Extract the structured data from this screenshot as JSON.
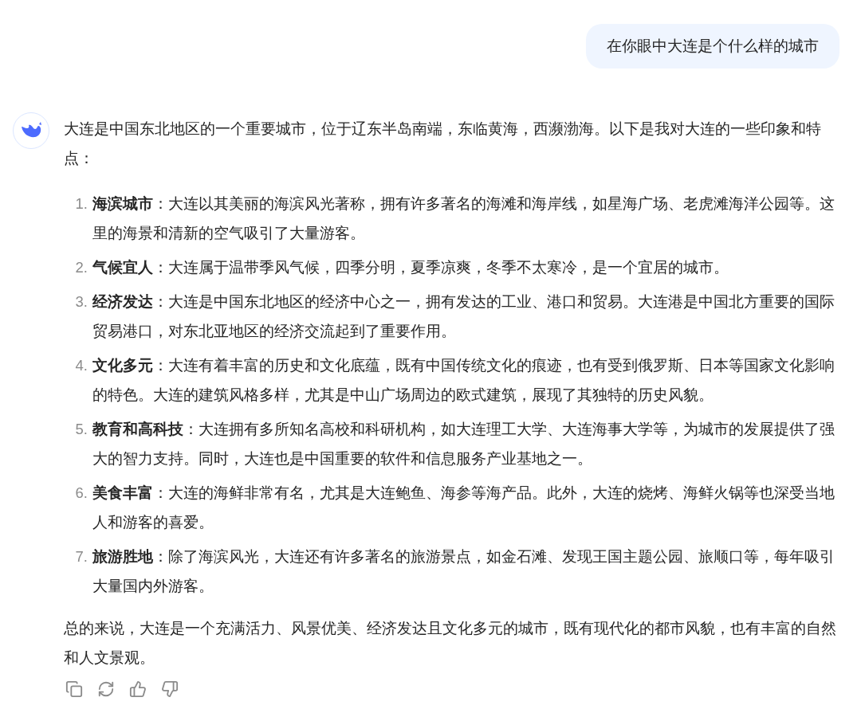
{
  "user_message": "在你眼中大连是个什么样的城市",
  "reply": {
    "intro": "大连是中国东北地区的一个重要城市，位于辽东半岛南端，东临黄海，西濒渤海。以下是我对大连的一些印象和特点：",
    "items": [
      {
        "number": "1.",
        "text": "**海滨城市**：大连以其美丽的海滨风光著称，拥有许多著名的海滩和海岸线，如星海广场、老虎滩海洋公园等。这里的海景和清新的空气吸引了大量游客。"
      },
      {
        "number": "2.",
        "text": "**气候宜人**：大连属于温带季风气候，四季分明，夏季凉爽，冬季不太寒冷，是一个宜居的城市。"
      },
      {
        "number": "3.",
        "text": "**经济发达**：大连是中国东北地区的经济中心之一，拥有发达的工业、港口和贸易。大连港是中国北方重要的国际贸易港口，对东北亚地区的经济交流起到了重要作用。"
      },
      {
        "number": "4.",
        "text": "**文化多元**：大连有着丰富的历史和文化底蕴，既有中国传统文化的痕迹，也有受到俄罗斯、日本等国家文化影响的特色。大连的建筑风格多样，尤其是中山广场周边的欧式建筑，展现了其独特的历史风貌。"
      },
      {
        "number": "5.",
        "text": "**教育和高科技**：大连拥有多所知名高校和科研机构，如大连理工大学、大连海事大学等，为城市的发展提供了强大的智力支持。同时，大连也是中国重要的软件和信息服务产业基地之一。"
      },
      {
        "number": "6.",
        "text": "**美食丰富**：大连的海鲜非常有名，尤其是大连鲍鱼、海参等海产品。此外，大连的烧烤、海鲜火锅等也深受当地人和游客的喜爱。"
      },
      {
        "number": "7.",
        "text": "**旅游胜地**：除了海滨风光，大连还有许多著名的旅游景点，如金石滩、发现王国主题公园、旅顺口等，每年吸引大量国内外游客。"
      }
    ],
    "conclusion": "总的来说，大连是一个充满活力、风景优美、经济发达且文化多元的城市，既有现代化的都市风貌，也有丰富的自然和人文景观。"
  },
  "actions": [
    {
      "kind": "copy"
    },
    {
      "kind": "regenerate"
    },
    {
      "kind": "like"
    },
    {
      "kind": "dislike"
    }
  ]
}
